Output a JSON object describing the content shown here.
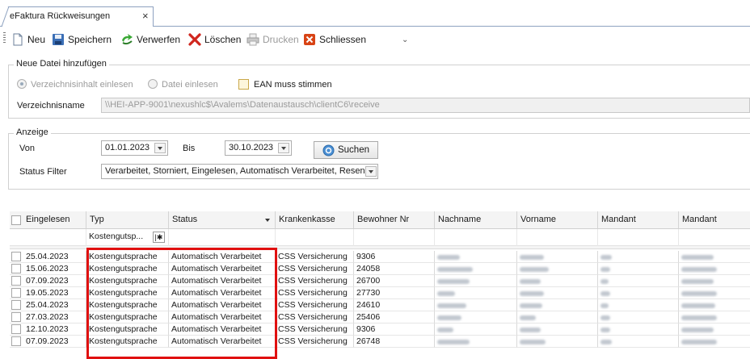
{
  "tab": {
    "title": "eFaktura Rückweisungen",
    "close": "×"
  },
  "toolbar": {
    "new_label": "Neu",
    "save_label": "Speichern",
    "discard_label": "Verwerfen",
    "delete_label": "Löschen",
    "print_label": "Drucken",
    "close_label": "Schliessen",
    "overflow": "⌄"
  },
  "new_file_group": {
    "legend": "Neue Datei hinzufügen",
    "radio_directory": "Verzeichnisinhalt einlesen",
    "radio_file": "Datei einlesen",
    "ean_label": "EAN muss stimmen",
    "directory_label": "Verzeichnisname",
    "directory_value": "\\\\HEI-APP-9001\\nexushlc$\\Avalems\\Datenaustausch\\clientC6\\receive"
  },
  "display_group": {
    "legend": "Anzeige",
    "from_label": "Von",
    "from_value": "01.01.2023",
    "to_label": "Bis",
    "to_value": "30.10.2023",
    "search_label": "Suchen",
    "status_filter_label": "Status Filter",
    "status_filter_value": "Verarbeitet, Storniert, Eingelesen, Automatisch Verarbeitet, Resend"
  },
  "grid": {
    "columns": [
      "Eingelesen",
      "Typ",
      "Status",
      "Krankenkasse",
      "Bewohner Nr",
      "Nachname",
      "Vorname",
      "Mandant",
      "Mandant"
    ],
    "filter_typ_value": "Kostengutsp...",
    "rows": [
      {
        "date": "25.04.2023",
        "typ": "Kostengutsprache",
        "status": "Automatisch Verarbeitet",
        "kasse": "CSS Versicherung",
        "nr": "9306"
      },
      {
        "date": "15.06.2023",
        "typ": "Kostengutsprache",
        "status": "Automatisch Verarbeitet",
        "kasse": "CSS Versicherung",
        "nr": "24058"
      },
      {
        "date": "07.09.2023",
        "typ": "Kostengutsprache",
        "status": "Automatisch Verarbeitet",
        "kasse": "CSS Versicherung",
        "nr": "26700"
      },
      {
        "date": "19.05.2023",
        "typ": "Kostengutsprache",
        "status": "Automatisch Verarbeitet",
        "kasse": "CSS Versicherung",
        "nr": "27730"
      },
      {
        "date": "25.04.2023",
        "typ": "Kostengutsprache",
        "status": "Automatisch Verarbeitet",
        "kasse": "CSS Versicherung",
        "nr": "24610"
      },
      {
        "date": "27.03.2023",
        "typ": "Kostengutsprache",
        "status": "Automatisch Verarbeitet",
        "kasse": "CSS Versicherung",
        "nr": "25406"
      },
      {
        "date": "12.10.2023",
        "typ": "Kostengutsprache",
        "status": "Automatisch Verarbeitet",
        "kasse": "CSS Versicherung",
        "nr": "9306"
      },
      {
        "date": "07.09.2023",
        "typ": "Kostengutsprache",
        "status": "Automatisch Verarbeitet",
        "kasse": "CSS Versicherung",
        "nr": "26748"
      }
    ]
  },
  "colors": {
    "highlight": "#e01010",
    "tab_border": "#8ea2c0"
  }
}
